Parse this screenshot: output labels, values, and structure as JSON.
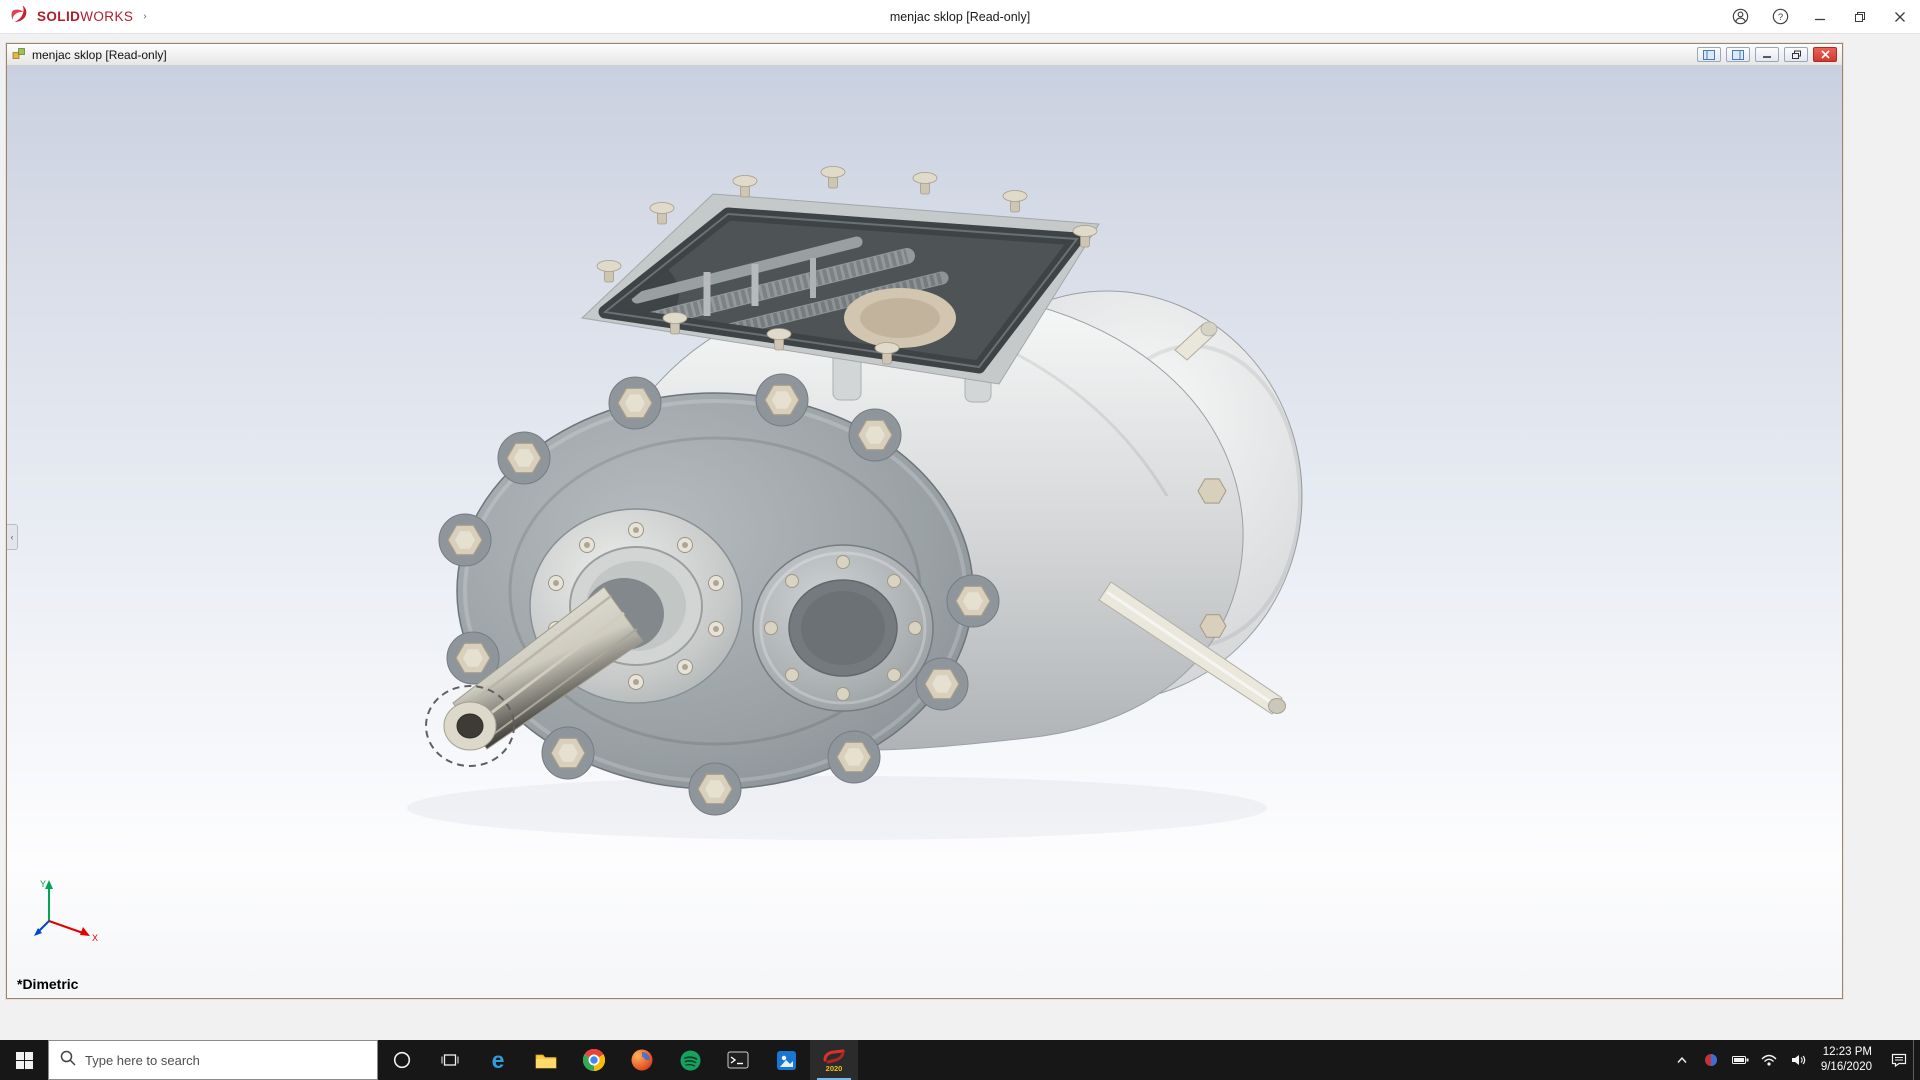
{
  "app": {
    "brand": {
      "solid": "SOLID",
      "works": "WORKS"
    },
    "titlebar": {
      "title": "menjac sklop [Read-only]"
    }
  },
  "doc": {
    "title": "menjac sklop [Read-only]"
  },
  "viewport": {
    "view_label": "*Dimetric",
    "triad": {
      "x": "X",
      "y": "Y"
    }
  },
  "taskbar": {
    "search_placeholder": "Type here to search",
    "solidworks_year": "2020",
    "clock": {
      "time": "12:23 PM",
      "date": "9/16/2020"
    }
  },
  "glyphs": {
    "help": "?",
    "brand_arrow": "›",
    "collapse_arrow": "‹",
    "edge": "e",
    "terminal": "&gt;_"
  },
  "icons": {
    "app_titlebar": [
      "account-icon",
      "help-icon",
      "minimize-icon",
      "restore-icon",
      "close-icon"
    ],
    "doc_titlebar": [
      "assembly-doc-icon",
      "panel-icon-1",
      "panel-icon-2",
      "minimize-icon",
      "restore-icon",
      "close-icon"
    ],
    "taskbar": [
      "start-icon",
      "search-icon",
      "cortana-icon",
      "task-view-icon",
      "edge-icon",
      "file-explorer-icon",
      "chrome-icon",
      "app-icon-4",
      "app-icon-5",
      "terminal-icon",
      "app-icon-7",
      "solidworks-icon"
    ],
    "tray": [
      "chevron-up-icon",
      "tray-app-icon",
      "battery-icon",
      "network-icon",
      "volume-icon",
      "action-center-icon"
    ]
  },
  "colors": {
    "brand_red": "#b01e28",
    "doc_close_red": "#d03a2f",
    "taskbar_bg": "#171717",
    "viewport_top": "#c9d0df",
    "viewport_bottom": "#f5f6f8",
    "active_underline": "#76b9ed"
  }
}
